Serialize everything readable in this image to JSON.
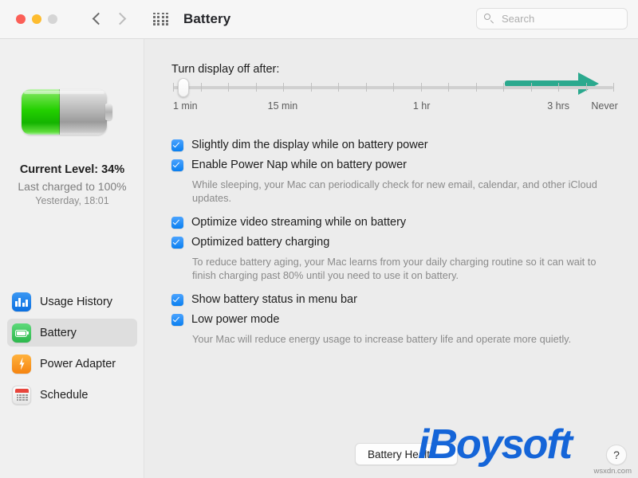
{
  "window": {
    "title": "Battery",
    "traffic_lights": [
      "close",
      "minimize",
      "zoom"
    ],
    "back_label": "Back",
    "forward_label": "Forward",
    "grid_label": "Show All"
  },
  "search": {
    "placeholder": "Search",
    "value": ""
  },
  "sidebar": {
    "battery": {
      "fill_percent": 45,
      "current_level": "Current Level: 34%",
      "last_charged": "Last charged to 100%",
      "last_charged_time": "Yesterday, 18:01"
    },
    "items": [
      {
        "label": "Usage History",
        "icon": "usage-history-icon",
        "selected": false
      },
      {
        "label": "Battery",
        "icon": "battery-icon",
        "selected": true
      },
      {
        "label": "Power Adapter",
        "icon": "power-adapter-icon",
        "selected": false
      },
      {
        "label": "Schedule",
        "icon": "schedule-icon",
        "selected": false
      }
    ]
  },
  "main": {
    "slider": {
      "label": "Turn display off after:",
      "value_percent": 2.4,
      "tick_count": 17,
      "tick_labels": [
        {
          "text": "1 min",
          "left_percent": 0
        },
        {
          "text": "15 min",
          "left_percent": 21.5
        },
        {
          "text": "1 hr",
          "left_percent": 54.5
        },
        {
          "text": "3 hrs",
          "left_percent": 85
        },
        {
          "text": "Never",
          "left_percent": 95
        }
      ],
      "annotation_color": "#2ba98e"
    },
    "options": [
      {
        "label": "Slightly dim the display while on battery power",
        "checked": true,
        "description": ""
      },
      {
        "label": "Enable Power Nap while on battery power",
        "checked": true,
        "description": "While sleeping, your Mac can periodically check for new email, calendar, and other iCloud updates."
      },
      {
        "label": "Optimize video streaming while on battery",
        "checked": true,
        "description": ""
      },
      {
        "label": "Optimized battery charging",
        "checked": true,
        "description": "To reduce battery aging, your Mac learns from your daily charging routine so it can wait to finish charging past 80% until you need to use it on battery."
      },
      {
        "label": "Show battery status in menu bar",
        "checked": true,
        "description": ""
      },
      {
        "label": "Low power mode",
        "checked": true,
        "description": "Your Mac will reduce energy usage to increase battery life and operate more quietly."
      }
    ]
  },
  "footer": {
    "battery_health_button": "Battery Health...",
    "help_button": "?"
  },
  "watermark": {
    "logo": "iBoysoft",
    "site": "wsxdn.com",
    "logo_color": "#1565d8"
  },
  "colors": {
    "checkbox_blue": "#0a7ff0",
    "battery_green": "#23d000",
    "accent_teal": "#2ba98e",
    "sidebar_bg": "#f0f0f0",
    "main_bg": "#ececec"
  }
}
